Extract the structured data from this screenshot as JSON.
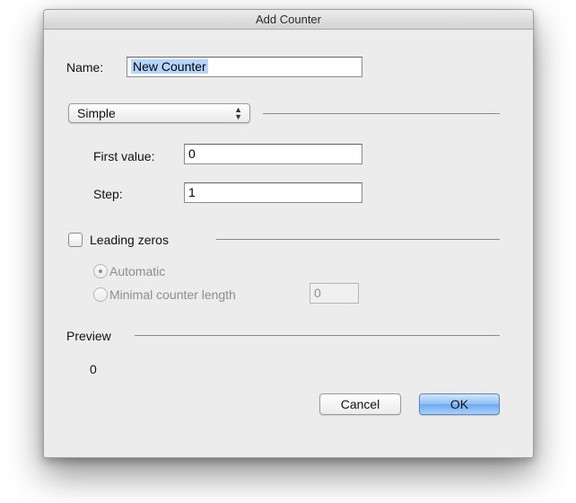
{
  "window": {
    "title": "Add Counter"
  },
  "name_field": {
    "label": "Name:",
    "value": "New Counter"
  },
  "type_popup": {
    "selected": "Simple",
    "arrows_icon": "updown-chevron-icon"
  },
  "first_value": {
    "label": "First value:",
    "value": "0"
  },
  "step": {
    "label": "Step:",
    "value": "1"
  },
  "leading_zeros": {
    "label": "Leading zeros",
    "checked": false,
    "enabled_options": false,
    "options": [
      {
        "label": "Automatic",
        "selected": true
      },
      {
        "label": "Minimal counter length",
        "selected": false
      }
    ],
    "min_length_value": "0"
  },
  "preview": {
    "label": "Preview",
    "value": "0"
  },
  "buttons": {
    "cancel": "Cancel",
    "ok": "OK"
  },
  "colors": {
    "ok_button": "#8fbff5",
    "selection": "#b6d5fc"
  }
}
